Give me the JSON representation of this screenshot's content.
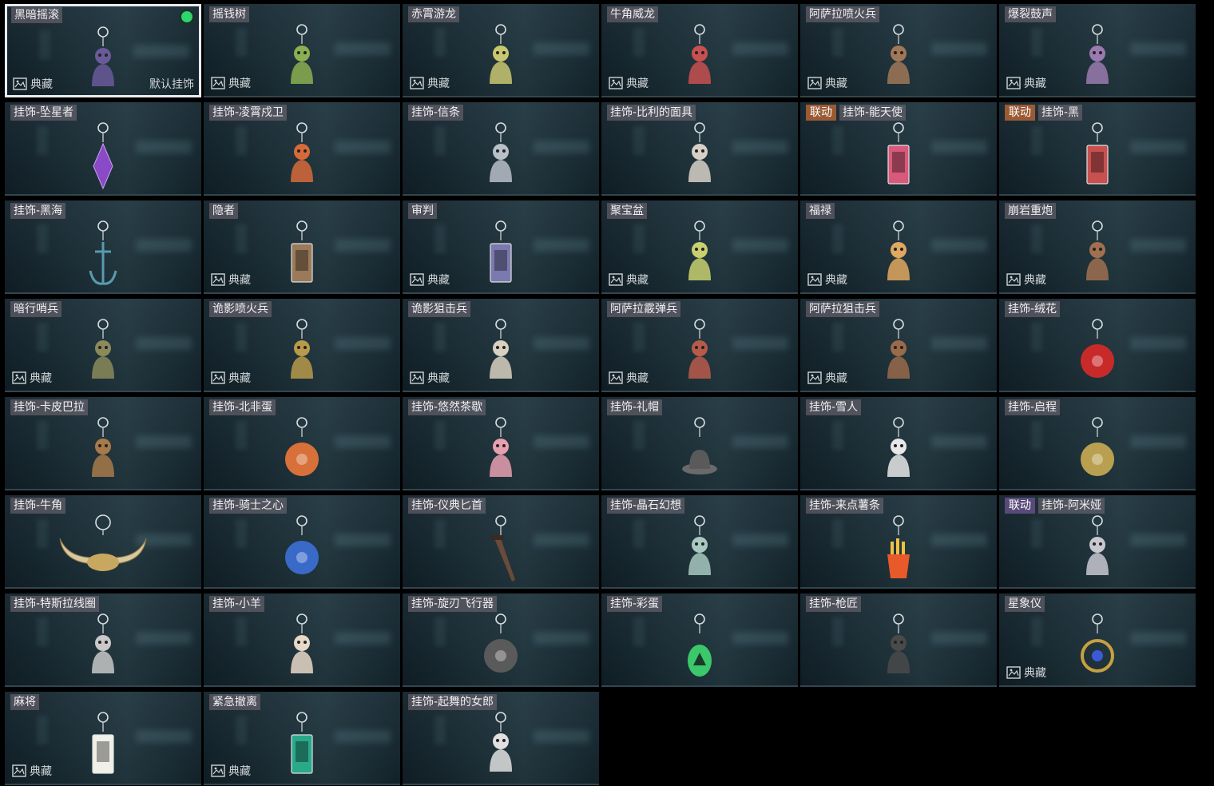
{
  "collect_label": "典藏",
  "default_label": "默认挂饰",
  "cards": [
    {
      "name": "黑暗摇滚",
      "badge": null,
      "collect": true,
      "selected": true,
      "icon": "rock-figure-charm-icon",
      "color": "#6a5a9a"
    },
    {
      "name": "摇钱树",
      "badge": null,
      "collect": true,
      "icon": "money-tree-charm-icon",
      "color": "#8ab050"
    },
    {
      "name": "赤霄游龙",
      "badge": null,
      "collect": true,
      "icon": "dragon-figure-charm-icon",
      "color": "#c8c870"
    },
    {
      "name": "牛角威龙",
      "badge": null,
      "collect": true,
      "icon": "horned-figure-charm-icon",
      "color": "#c85050"
    },
    {
      "name": "阿萨拉喷火兵",
      "badge": null,
      "collect": true,
      "icon": "flamethrower-soldier-charm-icon",
      "color": "#a07858"
    },
    {
      "name": "爆裂鼓声",
      "badge": null,
      "collect": true,
      "icon": "drum-figure-charm-icon",
      "color": "#9a7ab0"
    },
    {
      "name": "挂饰-坠星者",
      "badge": null,
      "collect": false,
      "icon": "purple-crystal-charm-icon",
      "color": "#8a4ac8"
    },
    {
      "name": "挂饰-凌霄戍卫",
      "badge": null,
      "collect": false,
      "icon": "rocket-charm-icon",
      "color": "#d86a3a"
    },
    {
      "name": "挂饰-信条",
      "badge": null,
      "collect": false,
      "icon": "silver-bird-charm-icon",
      "color": "#b8c0c8"
    },
    {
      "name": "挂饰-比利的面具",
      "badge": null,
      "collect": false,
      "icon": "puppet-mask-charm-icon",
      "color": "#d8d0c8"
    },
    {
      "name": "挂饰-能天使",
      "badge": "联动",
      "badge_style": "orange",
      "collect": false,
      "icon": "energy-drink-charm-icon",
      "color": "#d85a7a"
    },
    {
      "name": "挂饰-黑",
      "badge": "联动",
      "badge_style": "orange",
      "collect": false,
      "icon": "drink-bottle-charm-icon",
      "color": "#c85050"
    },
    {
      "name": "挂饰-黑海",
      "badge": null,
      "collect": false,
      "icon": "anchor-charm-icon",
      "color": "#5a9ab0"
    },
    {
      "name": "隐者",
      "badge": null,
      "collect": true,
      "icon": "tarot-card-charm-icon",
      "color": "#9a7a5a"
    },
    {
      "name": "审判",
      "badge": null,
      "collect": true,
      "icon": "tarot-card-charm-icon",
      "color": "#7a7ab0"
    },
    {
      "name": "聚宝盆",
      "badge": null,
      "collect": true,
      "icon": "treasure-bowl-charm-icon",
      "color": "#c8d070"
    },
    {
      "name": "福禄",
      "badge": null,
      "collect": true,
      "icon": "gourd-charm-icon",
      "color": "#e0a860"
    },
    {
      "name": "崩岩重炮",
      "badge": null,
      "collect": true,
      "icon": "cannon-figure-charm-icon",
      "color": "#a07050"
    },
    {
      "name": "暗行哨兵",
      "badge": null,
      "collect": true,
      "icon": "sentinel-figure-charm-icon",
      "color": "#8a8a5a"
    },
    {
      "name": "诡影喷火兵",
      "badge": null,
      "collect": true,
      "icon": "shadow-flamer-charm-icon",
      "color": "#b89a4a"
    },
    {
      "name": "诡影狙击兵",
      "badge": null,
      "collect": true,
      "icon": "shadow-sniper-charm-icon",
      "color": "#d8d0c0"
    },
    {
      "name": "阿萨拉霰弹兵",
      "badge": null,
      "collect": true,
      "icon": "shotgun-soldier-charm-icon",
      "color": "#b85a4a"
    },
    {
      "name": "阿萨拉狙击兵",
      "badge": null,
      "collect": true,
      "icon": "sniper-soldier-charm-icon",
      "color": "#9a6a4a"
    },
    {
      "name": "挂饰-绒花",
      "badge": null,
      "collect": false,
      "icon": "rose-charm-icon",
      "color": "#c82a2a"
    },
    {
      "name": "挂饰-卡皮巴拉",
      "badge": null,
      "collect": false,
      "icon": "capybara-charm-icon",
      "color": "#a87a4a"
    },
    {
      "name": "挂饰-北非蛋",
      "badge": null,
      "collect": false,
      "icon": "shakshuka-charm-icon",
      "color": "#d8703a"
    },
    {
      "name": "挂饰-悠然茶歇",
      "badge": null,
      "collect": false,
      "icon": "cupcake-charm-icon",
      "color": "#e8a0b0"
    },
    {
      "name": "挂饰-礼帽",
      "badge": null,
      "collect": false,
      "icon": "top-hat-charm-icon",
      "color": "#6a6a6a"
    },
    {
      "name": "挂饰-雪人",
      "badge": null,
      "collect": false,
      "icon": "snowman-charm-icon",
      "color": "#e8e8e8"
    },
    {
      "name": "挂饰-启程",
      "badge": null,
      "collect": false,
      "icon": "compass-medal-charm-icon",
      "color": "#b8a050"
    },
    {
      "name": "挂饰-牛角",
      "badge": null,
      "collect": false,
      "icon": "bull-horns-charm-icon",
      "color": "#c8a860"
    },
    {
      "name": "挂饰-骑士之心",
      "badge": null,
      "collect": false,
      "icon": "knight-cross-charm-icon",
      "color": "#3a6ac8"
    },
    {
      "name": "挂饰-仪典匕首",
      "badge": null,
      "collect": false,
      "icon": "dagger-charm-icon",
      "color": "#6a4a3a"
    },
    {
      "name": "挂饰-晶石幻想",
      "badge": null,
      "collect": false,
      "icon": "crystal-cube-charm-icon",
      "color": "#a8c8c0"
    },
    {
      "name": "挂饰-来点薯条",
      "badge": null,
      "collect": false,
      "icon": "fries-charm-icon",
      "color": "#e85a2a"
    },
    {
      "name": "挂饰-阿米娅",
      "badge": "联动",
      "badge_style": "purple",
      "collect": false,
      "icon": "bunny-figure-charm-icon",
      "color": "#c8c8d0"
    },
    {
      "name": "挂饰-特斯拉线圈",
      "badge": null,
      "collect": false,
      "icon": "tesla-coil-charm-icon",
      "color": "#c8c8c8"
    },
    {
      "name": "挂饰-小羊",
      "badge": null,
      "collect": false,
      "icon": "lamb-charm-icon",
      "color": "#e8d8c8"
    },
    {
      "name": "挂饰-旋刃飞行器",
      "badge": null,
      "collect": false,
      "icon": "blade-drone-charm-icon",
      "color": "#5a5a5a"
    },
    {
      "name": "挂饰-彩蛋",
      "badge": null,
      "collect": false,
      "icon": "green-egg-charm-icon",
      "color": "#3ac86a"
    },
    {
      "name": "挂饰-枪匠",
      "badge": null,
      "collect": false,
      "icon": "backpack-charm-icon",
      "color": "#4a4a4a"
    },
    {
      "name": "星象仪",
      "badge": null,
      "collect": true,
      "icon": "astrolabe-charm-icon",
      "color": "#c8a040"
    },
    {
      "name": "麻将",
      "badge": null,
      "collect": true,
      "icon": "mahjong-tile-charm-icon",
      "color": "#f0f0e8"
    },
    {
      "name": "紧急撤离",
      "badge": null,
      "collect": true,
      "icon": "exit-sign-charm-icon",
      "color": "#2aa88a"
    },
    {
      "name": "挂饰-起舞的女郎",
      "badge": null,
      "collect": false,
      "icon": "dancer-statue-charm-icon",
      "color": "#e0e0e0"
    }
  ]
}
